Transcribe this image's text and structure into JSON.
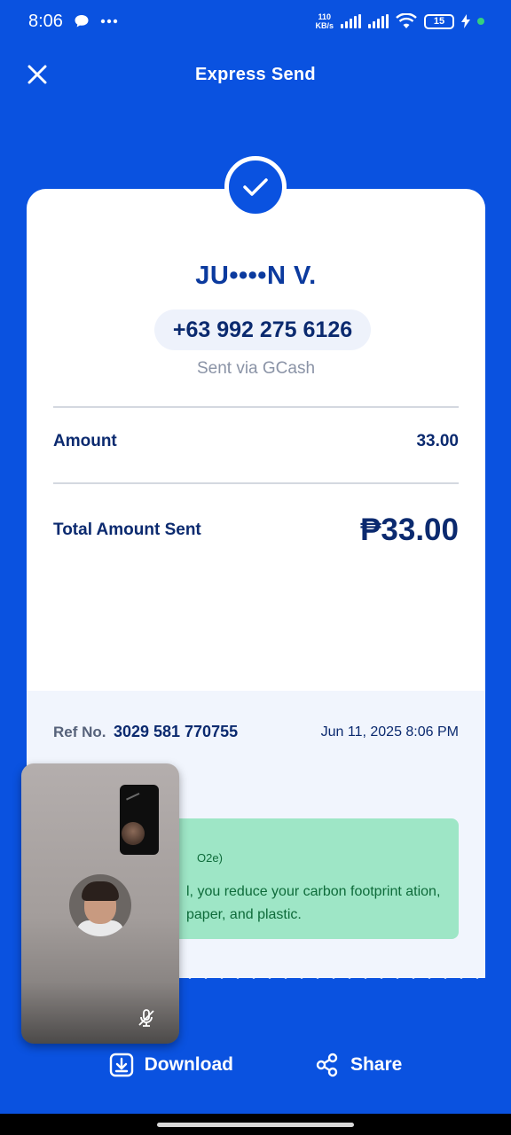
{
  "status_bar": {
    "time": "8:06",
    "net_speed_value": "110",
    "net_speed_unit": "KB/s",
    "battery": "15"
  },
  "header": {
    "title": "Express Send"
  },
  "receipt": {
    "recipient_name": "JU••••N V.",
    "phone": "+63 992 275 6126",
    "sent_via": "Sent via GCash",
    "amount_label": "Amount",
    "amount_value": "33.00",
    "total_label": "Total Amount Sent",
    "total_value": "₱33.00",
    "ref_label": "Ref No.",
    "ref_number": "3029 581 770755",
    "date": "Jun 11, 2025 8:06 PM",
    "banner_title_fragment": "O2e)",
    "banner_text": "l, you reduce your carbon footprint ation, paper, and plastic."
  },
  "actions": {
    "download": "Download",
    "share": "Share"
  },
  "colors": {
    "brand_blue": "#0A52E0",
    "text_navy": "#0b2a6f",
    "banner_green": "#9ee6c6"
  }
}
